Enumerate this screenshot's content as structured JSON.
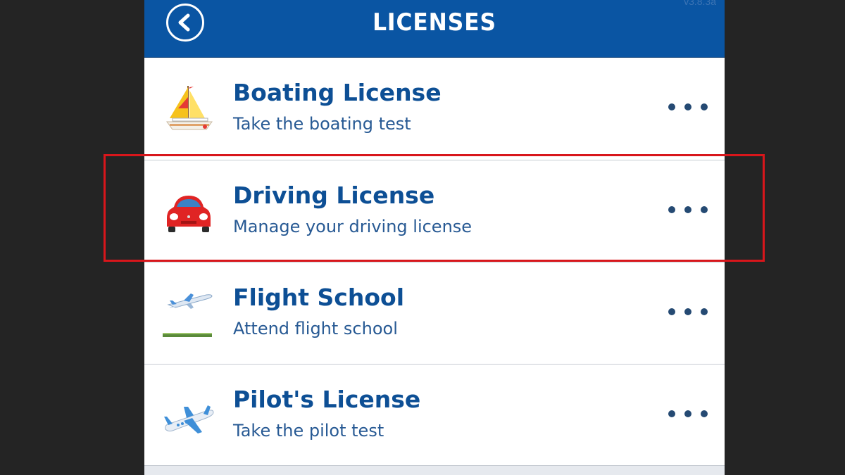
{
  "header": {
    "title": "LICENSES",
    "version": "v3.8.3a"
  },
  "licenses": [
    {
      "title": "Boating License",
      "subtitle": "Take the boating test",
      "icon": "sailboat-icon"
    },
    {
      "title": "Driving License",
      "subtitle": "Manage your driving license",
      "icon": "car-icon"
    },
    {
      "title": "Flight School",
      "subtitle": "Attend flight school",
      "icon": "airplane-takeoff-icon"
    },
    {
      "title": "Pilot's License",
      "subtitle": "Take the pilot test",
      "icon": "jet-icon"
    }
  ],
  "colors": {
    "header_bg": "#0a55a3",
    "title_text": "#0d4f95",
    "subtitle_text": "#285a94",
    "more_dots": "#254a73",
    "highlight": "#d8161b"
  }
}
